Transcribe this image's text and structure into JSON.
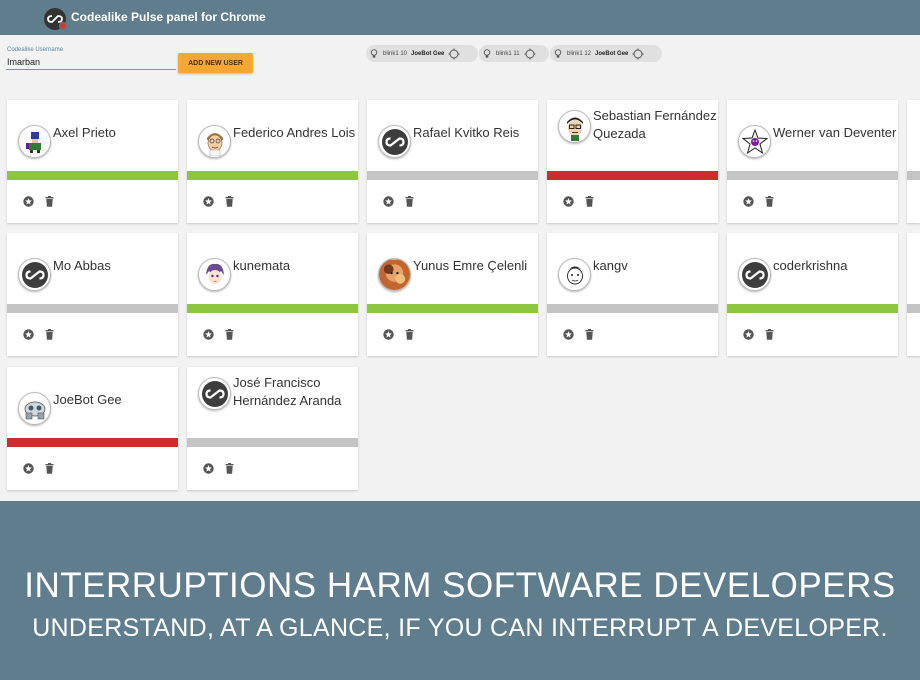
{
  "app": {
    "title": "Codealike Pulse panel for Chrome"
  },
  "form": {
    "username_label": "Codealike Username",
    "username_value": "Imarban",
    "add_button": "ADD NEW USER"
  },
  "chips": [
    {
      "light": "blink1 10",
      "user": "JoeBot Gee"
    },
    {
      "light": "blink1 11",
      "user": ""
    },
    {
      "light": "blink1 12",
      "user": "JoeBot Gee"
    }
  ],
  "colors": {
    "available": "#8dc63f",
    "offline": "#c4c4c4",
    "busy": "#cc2e2e",
    "topbar": "#5f7d8c",
    "button": "#f5a733"
  },
  "cards": [
    {
      "name": "Axel Prieto",
      "status": "available",
      "avatar": "pixel-avatar-icon"
    },
    {
      "name": "Federico Andres Lois",
      "status": "available",
      "avatar": "cartoon-face-icon"
    },
    {
      "name": "Rafael Kvitko Reis",
      "status": "offline",
      "avatar": "codealike-logo-icon"
    },
    {
      "name": "Sebastian Fernández Quezada",
      "status": "busy",
      "avatar": "glasses-face-icon"
    },
    {
      "name": "Werner van Deventer",
      "status": "offline",
      "avatar": "star-avatar-icon"
    },
    {
      "name": "Mo Abbas",
      "status": "offline",
      "avatar": "codealike-logo-icon"
    },
    {
      "name": "kunemata",
      "status": "available",
      "avatar": "anime-face-icon"
    },
    {
      "name": "Yunus Emre Çelenli",
      "status": "available",
      "avatar": "photo-avatar-icon"
    },
    {
      "name": "kangv",
      "status": "offline",
      "avatar": "sketch-face-icon"
    },
    {
      "name": "coderkrishna",
      "status": "available",
      "avatar": "codealike-logo-icon"
    },
    {
      "name": "JoeBot Gee",
      "status": "busy",
      "avatar": "robot-avatar-icon"
    },
    {
      "name": "José Francisco Hernández Aranda",
      "status": "offline",
      "avatar": "codealike-logo-icon"
    }
  ],
  "banner": {
    "headline": "INTERRUPTIONS HARM SOFTWARE DEVELOPERS",
    "subline": "UNDERSTAND, AT A GLANCE, IF YOU CAN INTERRUPT A DEVELOPER."
  }
}
